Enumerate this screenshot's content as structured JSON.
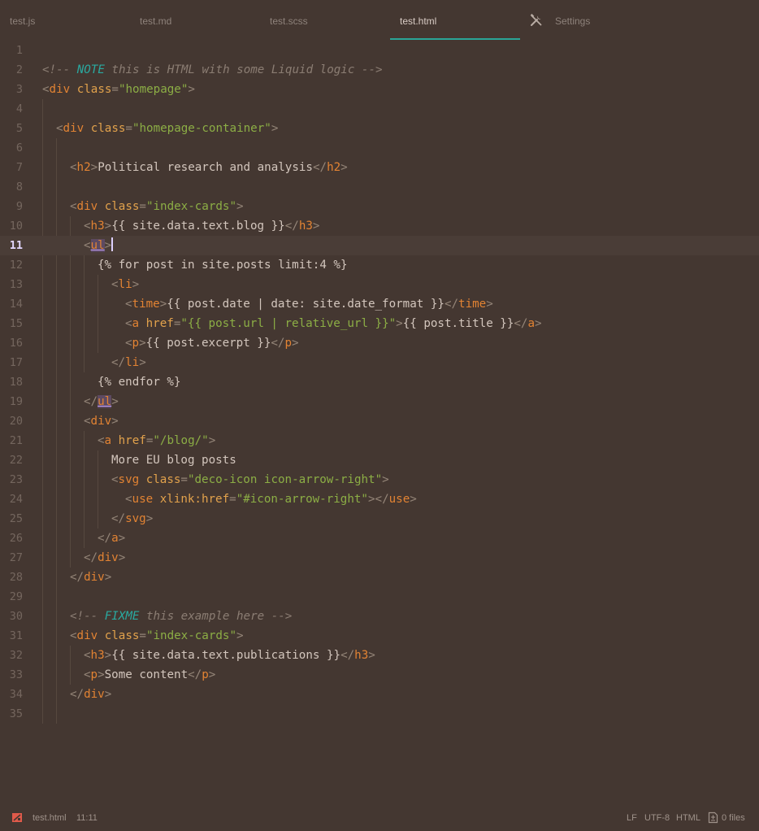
{
  "tabs": [
    {
      "label": "test.js",
      "active": false
    },
    {
      "label": "test.md",
      "active": false
    },
    {
      "label": "test.scss",
      "active": false
    },
    {
      "label": "test.html",
      "active": true
    },
    {
      "label": "Settings",
      "active": false,
      "icon": "tools-icon"
    }
  ],
  "editor": {
    "current_line": 11,
    "lines": [
      {
        "n": "1"
      },
      {
        "n": "2",
        "t1": "<!-- ",
        "t2": "NOTE",
        "t3": " this is HTML with some Liquid logic -->"
      },
      {
        "n": "3",
        "t1": "<",
        "t2": "div",
        "t3": " class",
        "t4": "=",
        "t5": "\"homepage\"",
        "t6": ">"
      },
      {
        "n": "4"
      },
      {
        "n": "5",
        "t1": "<",
        "t2": "div",
        "t3": " class",
        "t4": "=",
        "t5": "\"homepage-container\"",
        "t6": ">"
      },
      {
        "n": "6"
      },
      {
        "n": "7",
        "t1": "<",
        "t2": "h2",
        "t3": ">",
        "t4": "Political research and analysis",
        "t5": "</",
        "t6": "h2",
        "t7": ">"
      },
      {
        "n": "8"
      },
      {
        "n": "9",
        "t1": "<",
        "t2": "div",
        "t3": " class",
        "t4": "=",
        "t5": "\"index-cards\"",
        "t6": ">"
      },
      {
        "n": "10",
        "t1": "<",
        "t2": "h3",
        "t3": ">",
        "t4": "{{ site.data.text.blog }}",
        "t5": "</",
        "t6": "h3",
        "t7": ">"
      },
      {
        "n": "11",
        "t1": "<",
        "t2": "ul",
        "t3": ">"
      },
      {
        "n": "12",
        "t1": "{% for post in site.posts limit:4 %}"
      },
      {
        "n": "13",
        "t1": "<",
        "t2": "li",
        "t3": ">"
      },
      {
        "n": "14",
        "t1": "<",
        "t2": "time",
        "t3": ">",
        "t4": "{{ post.date | date: site.date_format }}",
        "t5": "</",
        "t6": "time",
        "t7": ">"
      },
      {
        "n": "15",
        "t1": "<",
        "t2": "a",
        "t3": " href",
        "t4": "=",
        "t5": "\"{{ post.url | relative_url }}\"",
        "t6": ">",
        "t7": "{{ post.title }}",
        "t8": "</",
        "t9": "a",
        "t10": ">"
      },
      {
        "n": "16",
        "t1": "<",
        "t2": "p",
        "t3": ">",
        "t4": "{{ post.excerpt }}",
        "t5": "</",
        "t6": "p",
        "t7": ">"
      },
      {
        "n": "17",
        "t1": "</",
        "t2": "li",
        "t3": ">"
      },
      {
        "n": "18",
        "t1": "{% endfor %}"
      },
      {
        "n": "19",
        "t1": "</",
        "t2": "ul",
        "t3": ">"
      },
      {
        "n": "20",
        "t1": "<",
        "t2": "div",
        "t3": ">"
      },
      {
        "n": "21",
        "t1": "<",
        "t2": "a",
        "t3": " href",
        "t4": "=",
        "t5": "\"/blog/\"",
        "t6": ">"
      },
      {
        "n": "22",
        "t1": "More EU blog posts"
      },
      {
        "n": "23",
        "t1": "<",
        "t2": "svg",
        "t3": " class",
        "t4": "=",
        "t5": "\"deco-icon icon-arrow-right\"",
        "t6": ">"
      },
      {
        "n": "24",
        "t1": "<",
        "t2": "use",
        "t3": " xlink:href",
        "t4": "=",
        "t5": "\"#icon-arrow-right\"",
        "t6": "></",
        "t7": "use",
        "t8": ">"
      },
      {
        "n": "25",
        "t1": "</",
        "t2": "svg",
        "t3": ">"
      },
      {
        "n": "26",
        "t1": "</",
        "t2": "a",
        "t3": ">"
      },
      {
        "n": "27",
        "t1": "</",
        "t2": "div",
        "t3": ">"
      },
      {
        "n": "28",
        "t1": "</",
        "t2": "div",
        "t3": ">"
      },
      {
        "n": "29"
      },
      {
        "n": "30",
        "t1": "<!-- ",
        "t2": "FIXME",
        "t3": " this example here -->"
      },
      {
        "n": "31",
        "t1": "<",
        "t2": "div",
        "t3": " class",
        "t4": "=",
        "t5": "\"index-cards\"",
        "t6": ">"
      },
      {
        "n": "32",
        "t1": "<",
        "t2": "h3",
        "t3": ">",
        "t4": "{{ site.data.text.publications }}",
        "t5": "</",
        "t6": "h3",
        "t7": ">"
      },
      {
        "n": "33",
        "t1": "<",
        "t2": "p",
        "t3": ">",
        "t4": "Some content",
        "t5": "</",
        "t6": "p",
        "t7": ">"
      },
      {
        "n": "34",
        "t1": "</",
        "t2": "div",
        "t3": ">"
      },
      {
        "n": "35"
      }
    ]
  },
  "status": {
    "icon": "error-icon",
    "file": "test.html",
    "position": "11:11",
    "eol": "LF",
    "encoding": "UTF-8",
    "grammar": "HTML",
    "git_icon": "file-diff-icon",
    "files": "0 files"
  },
  "colors": {
    "background": "#443731",
    "accent": "#2aa597",
    "tag": "#e28333",
    "attribute": "#e2a24c",
    "string": "#8cae45",
    "comment": "#8b7d73",
    "note": "#2aa9a0"
  }
}
